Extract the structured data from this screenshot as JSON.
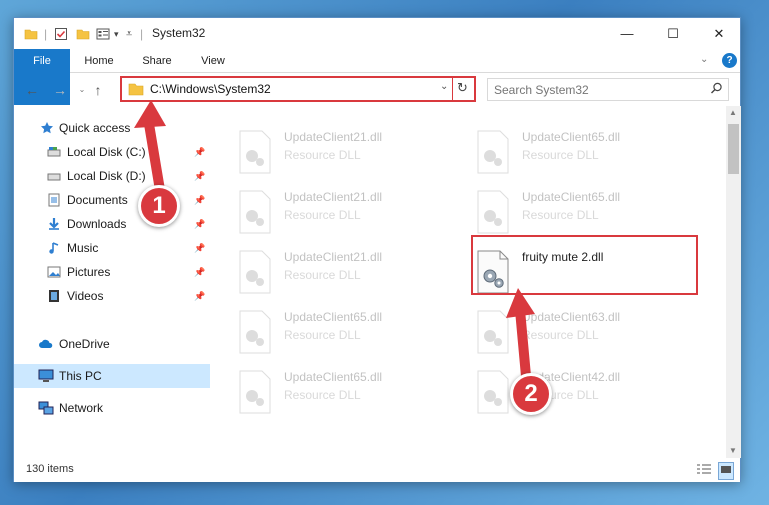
{
  "window": {
    "title": "System32",
    "controls": {
      "minimize": "—",
      "maximize": "☐",
      "close": "✕"
    }
  },
  "ribbon": {
    "tabs": [
      {
        "label": "File"
      },
      {
        "label": "Home"
      },
      {
        "label": "Share"
      },
      {
        "label": "View"
      }
    ]
  },
  "address": {
    "path": "C:\\Windows\\System32",
    "search_placeholder": "Search System32"
  },
  "sidebar": {
    "items": [
      {
        "label": "Quick access",
        "icon": "star-icon"
      },
      {
        "label": "Local Disk (C:)",
        "icon": "drive-icon",
        "pinned": true
      },
      {
        "label": "Local Disk (D:)",
        "icon": "drive-icon",
        "pinned": true
      },
      {
        "label": "Documents",
        "icon": "documents-icon",
        "pinned": true
      },
      {
        "label": "Downloads",
        "icon": "download-icon",
        "pinned": true
      },
      {
        "label": "Music",
        "icon": "music-icon",
        "pinned": true
      },
      {
        "label": "Pictures",
        "icon": "pictures-icon",
        "pinned": true
      },
      {
        "label": "Videos",
        "icon": "videos-icon",
        "pinned": true
      },
      {
        "label": "OneDrive",
        "icon": "cloud-icon"
      },
      {
        "label": "This PC",
        "icon": "computer-icon",
        "selected": true
      },
      {
        "label": "Network",
        "icon": "network-icon"
      }
    ]
  },
  "files": [
    {
      "name": "UpdateClient21.dll",
      "type": "Resource DLL"
    },
    {
      "name": "UpdateClient65.dll",
      "type": "Resource DLL"
    },
    {
      "name": "UpdateClient21.dll",
      "type": "Resource DLL"
    },
    {
      "name": "UpdateClient65.dll",
      "type": "Resource DLL"
    },
    {
      "name": "UpdateClient21.dll",
      "type": "Resource DLL"
    },
    {
      "name": "fruity mute 2.dll",
      "type": ""
    },
    {
      "name": "UpdateClient65.dll",
      "type": "Resource DLL"
    },
    {
      "name": "UpdateClient63.dll",
      "type": "Resource DLL"
    },
    {
      "name": "UpdateClient65.dll",
      "type": "Resource DLL"
    },
    {
      "name": "UpdateClient42.dll",
      "type": "Resource DLL"
    }
  ],
  "status": {
    "item_count": "130 items"
  },
  "annotations": {
    "step1": "1",
    "step2": "2",
    "color": "#d9393e"
  },
  "colors": {
    "accent": "#1979ca",
    "selection": "#cce8ff",
    "highlight": "#d9393e"
  }
}
